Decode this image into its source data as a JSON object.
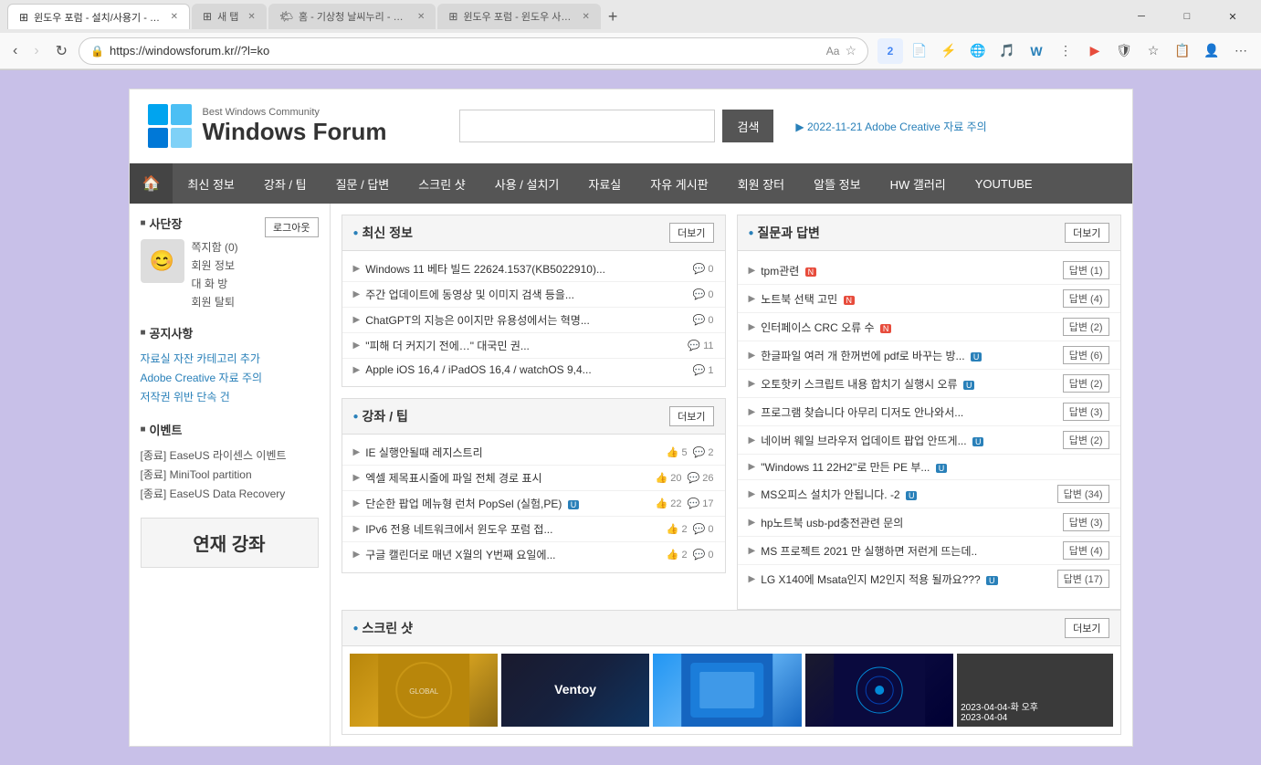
{
  "browser": {
    "tabs": [
      {
        "id": 1,
        "label": "윈도우 포럼 - 설치/사용기 - http...",
        "active": true,
        "icon": "windows"
      },
      {
        "id": 2,
        "label": "새 탭",
        "active": false,
        "icon": "new"
      },
      {
        "id": 3,
        "label": "홈 - 기상청 날씨누리 - https://w...",
        "active": false,
        "icon": "weather"
      },
      {
        "id": 4,
        "label": "윈도우 포럼 - 윈도우 사용자 모...",
        "active": false,
        "icon": "windows"
      }
    ],
    "url": "https://windowsforum.kr//?l=ko"
  },
  "header": {
    "logo_subtitle": "Best Windows Community",
    "logo_title": "Windows Forum",
    "search_placeholder": "",
    "search_btn": "검색",
    "notice": "▶ 2022-11-21 Adobe Creative 자료 주의"
  },
  "nav": {
    "items": [
      {
        "label": "🏠",
        "id": "home"
      },
      {
        "label": "최신 정보",
        "id": "latest"
      },
      {
        "label": "강좌 / 팁",
        "id": "lecture"
      },
      {
        "label": "질문 / 답변",
        "id": "qna"
      },
      {
        "label": "스크린 샷",
        "id": "screenshot"
      },
      {
        "label": "사용 / 설치기",
        "id": "usage"
      },
      {
        "label": "자료실",
        "id": "files"
      },
      {
        "label": "자유 게시판",
        "id": "free"
      },
      {
        "label": "회원 장터",
        "id": "market"
      },
      {
        "label": "알뜰 정보",
        "id": "frugal"
      },
      {
        "label": "HW 갤러리",
        "id": "hwgallery"
      },
      {
        "label": "YOUTUBE",
        "id": "youtube"
      }
    ]
  },
  "sidebar": {
    "section_user": "사단장",
    "logout_btn": "로그아웃",
    "user_links": [
      {
        "label": "쪽지함 (0)"
      },
      {
        "label": "회원 정보"
      },
      {
        "label": "대 화 방"
      },
      {
        "label": "회원 탈퇴"
      }
    ],
    "section_notice": "공지사항",
    "notices": [
      {
        "label": "자료실 자잔 카테고리 추가"
      },
      {
        "label": "Adobe Creative 자료 주의"
      },
      {
        "label": "저작권 위반 단속 건"
      }
    ],
    "section_event": "이벤트",
    "events": [
      {
        "label": "[종료] EaseUS 라이센스 이벤트"
      },
      {
        "label": "[종료] MiniTool partition"
      },
      {
        "label": "[종료] EaseUS Data Recovery"
      }
    ],
    "series_label": "연재 강좌"
  },
  "latest_news": {
    "title": "최신 정보",
    "more_btn": "더보기",
    "posts": [
      {
        "title": "Windows 11 베타 빌드 22624.1537(KB5022910)...",
        "comments": 0,
        "has_bubble": true
      },
      {
        "title": "주간 업데이트에 동영상 및 이미지 검색 등을...",
        "comments": 0,
        "has_bubble": true
      },
      {
        "title": "ChatGPT의 지능은 0이지만 유용성에서는 혁명...",
        "comments": 0,
        "has_bubble": true
      },
      {
        "title": "\"피해 더 커지기 전에…\" 대국민 권...",
        "comments": 11,
        "has_bubble": true
      },
      {
        "title": "Apple iOS 16,4 / iPadOS 16,4 / watchOS 9,4...",
        "comments": 1,
        "has_bubble": true
      }
    ]
  },
  "lectures": {
    "title": "강좌 / 팁",
    "more_btn": "더보기",
    "posts": [
      {
        "title": "IE 실행안될때 레지스트리",
        "likes": 5,
        "comments": 2
      },
      {
        "title": "엑셀 제목표시줄에 파일 전체 경로 표시",
        "likes": 20,
        "comments": 26
      },
      {
        "title": "단순한 팝업 메뉴형 런처 PopSel (실험,PE)",
        "likes": 22,
        "comments": 17,
        "badge": "U"
      },
      {
        "title": "IPv6 전용 네트워크에서 윈도우 포럼 접...",
        "likes": 2,
        "comments": 0
      },
      {
        "title": "구글 캘린더로 매년 X월의 Y번째 요일에...",
        "likes": 2,
        "comments": 0
      }
    ]
  },
  "qna": {
    "title": "질문과 답변",
    "more_btn": "더보기",
    "posts": [
      {
        "title": "tpm관련",
        "badge": "N",
        "reply": "답변 (1)"
      },
      {
        "title": "노트북 선택 고민",
        "badge": "N",
        "reply": "답변 (4)"
      },
      {
        "title": "인터페이스 CRC 오류 수",
        "badge": "N",
        "reply": "답변 (2)"
      },
      {
        "title": "한글파일 여러 개 한꺼번에 pdf로 바꾸는 방...",
        "badge": "U",
        "reply": "답변 (6)"
      },
      {
        "title": "오토핫키 스크립트 내용 합치기 실행시 오류",
        "badge": "U",
        "reply": "답변 (2)"
      },
      {
        "title": "프로그램 찾습니다 아무리 디저도 안나와서...",
        "reply": "답변 (3)"
      },
      {
        "title": "네이버 웨일 브라우저 업데이트 팝업 안뜨게...",
        "badge": "U",
        "reply": "답변 (2)"
      },
      {
        "title": "\"Windows 11 22H2\"로 만든 PE 부...",
        "badge": "U",
        "reply": null
      },
      {
        "title": "MS오피스 설치가 안됩니다. -2",
        "badge": "U",
        "reply": "답변 (34)"
      },
      {
        "title": "hp노트북 usb-pd충전관련 문의",
        "reply": "답변 (3)"
      },
      {
        "title": "MS 프로젝트 2021 만 실행하면 저런게 뜨는데..",
        "reply": "답변 (4)"
      },
      {
        "title": "LG X140에 Msata인지 M2인지 적용 될까요???",
        "badge": "U",
        "reply": "답변 (17)"
      }
    ]
  },
  "screenshots": {
    "title": "스크린 샷",
    "more_btn": "더보기",
    "items": [
      {
        "type": "gold",
        "label": ""
      },
      {
        "type": "ventoy",
        "label": "Ventoy"
      },
      {
        "type": "blue",
        "label": ""
      },
      {
        "type": "dark",
        "label": ""
      },
      {
        "type": "gray-bar",
        "label": "2023-04-04-화 오후\n2023-04-04"
      }
    ]
  }
}
